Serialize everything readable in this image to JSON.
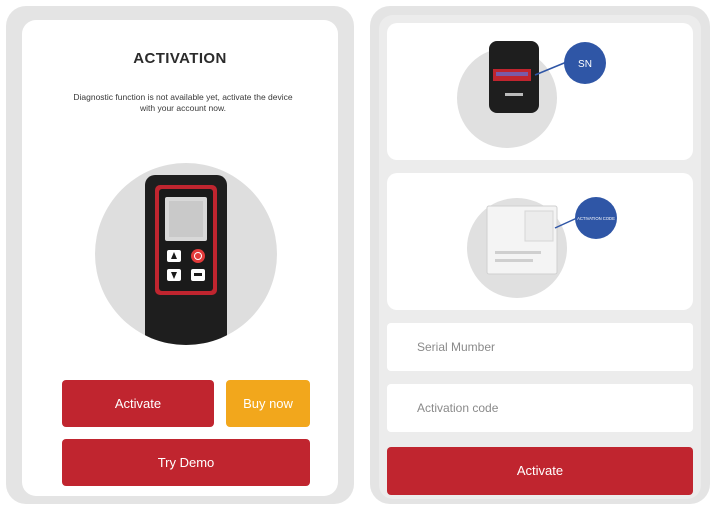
{
  "activation_screen": {
    "title": "ACTIVATION",
    "description": "Diagnostic function is not available yet, activate the device with your account now.",
    "activate_label": "Activate",
    "buy_now_label": "Buy now",
    "try_demo_label": "Try Demo"
  },
  "form_screen": {
    "sn_badge": "SN",
    "code_badge": "ACTIVATION CODE",
    "serial_number_placeholder": "Serial Mumber",
    "activation_code_placeholder": "Activation code",
    "activate_label": "Activate"
  },
  "colors": {
    "brand_red": "#c0252f",
    "accent_orange": "#f2a71c",
    "badge_blue": "#2f56a6"
  }
}
